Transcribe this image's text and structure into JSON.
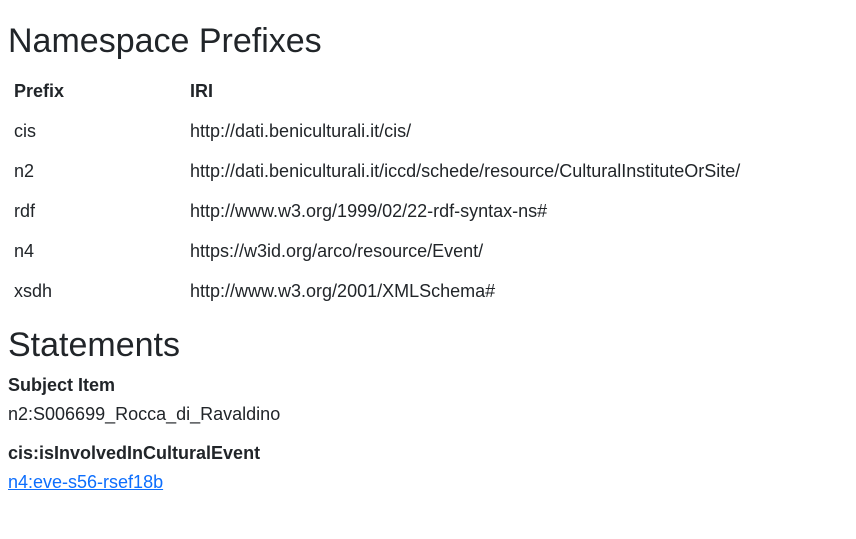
{
  "namespaces": {
    "title": "Namespace Prefixes",
    "headers": {
      "prefix": "Prefix",
      "iri": "IRI"
    },
    "rows": [
      {
        "prefix": "cis",
        "iri": "http://dati.beniculturali.it/cis/"
      },
      {
        "prefix": "n2",
        "iri": "http://dati.beniculturali.it/iccd/schede/resource/CulturalInstituteOrSite/"
      },
      {
        "prefix": "rdf",
        "iri": "http://www.w3.org/1999/02/22-rdf-syntax-ns#"
      },
      {
        "prefix": "n4",
        "iri": "https://w3id.org/arco/resource/Event/"
      },
      {
        "prefix": "xsdh",
        "iri": "http://www.w3.org/2001/XMLSchema#"
      }
    ]
  },
  "statements": {
    "title": "Statements",
    "subject_label": "Subject Item",
    "subject_value": "n2:S006699_Rocca_di_Ravaldino",
    "predicate": "cis:isInvolvedInCulturalEvent",
    "object_link": "n4:eve-s56-rsef18b"
  },
  "colors": {
    "text": "#212529",
    "link": "#0d6efd"
  }
}
